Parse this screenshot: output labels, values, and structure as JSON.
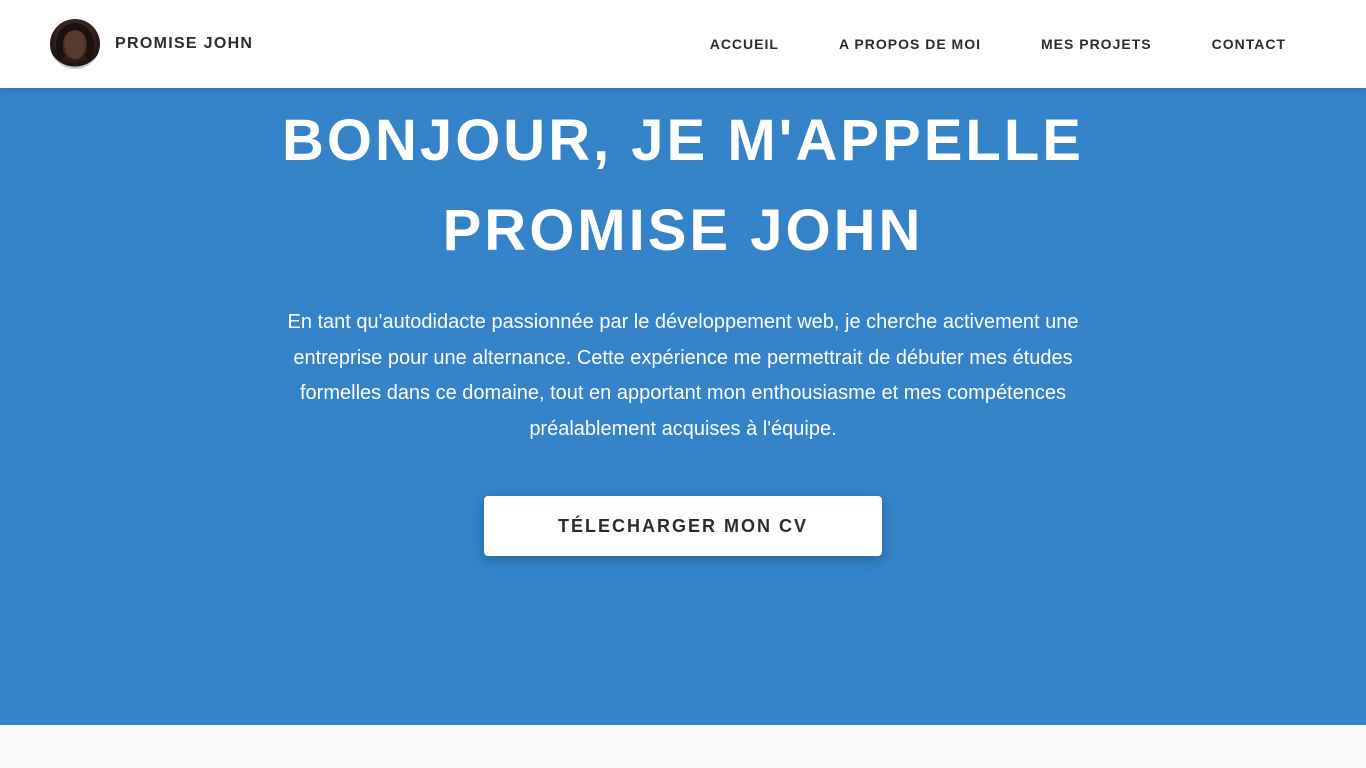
{
  "header": {
    "brand_name": "PROMISE JOHN",
    "nav": [
      {
        "label": "ACCUEIL"
      },
      {
        "label": "A PROPOS DE MOI"
      },
      {
        "label": "MES PROJETS"
      },
      {
        "label": "CONTACT"
      }
    ]
  },
  "hero": {
    "title_line1": "BONJOUR, JE M'APPELLE",
    "title_line2": "PROMISE JOHN",
    "text": "En tant qu'autodidacte passionnée par le développement web, je cherche activement une entreprise pour une alternance. Cette expérience me permettrait de débuter mes études formelles dans ce domaine, tout en apportant mon enthousiasme et mes compétences préalablement acquises à l'équipe.",
    "cv_button_label": "TÉLECHARGER MON CV"
  },
  "colors": {
    "hero_background": "#3483c8",
    "header_background": "#ffffff",
    "page_background": "#f7f7f7",
    "text_dark": "#2b2b2b"
  }
}
